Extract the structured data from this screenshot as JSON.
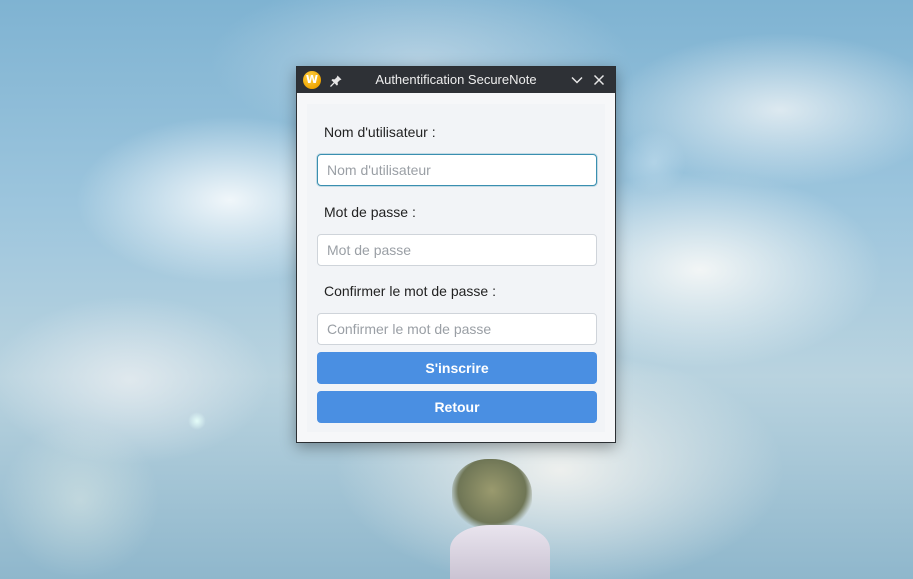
{
  "window": {
    "title": "Authentification SecureNote",
    "app_icon_letter": "W",
    "app_icon": "app-logo-icon",
    "pin_icon": "pin-icon",
    "minimize_icon": "chevron-down-icon",
    "close_icon": "close-icon"
  },
  "form": {
    "username": {
      "label": "Nom d'utilisateur :",
      "placeholder": "Nom d'utilisateur",
      "value": ""
    },
    "password": {
      "label": "Mot de passe :",
      "placeholder": "Mot de passe",
      "value": ""
    },
    "confirm_password": {
      "label": "Confirmer le mot de passe :",
      "placeholder": "Confirmer le mot de passe",
      "value": ""
    },
    "register_button": "S'inscrire",
    "back_button": "Retour"
  },
  "colors": {
    "titlebar": "#2e3136",
    "button_primary": "#4a8fe2",
    "focus_border": "#3a8fb0",
    "panel_bg": "#f2f4f7"
  }
}
